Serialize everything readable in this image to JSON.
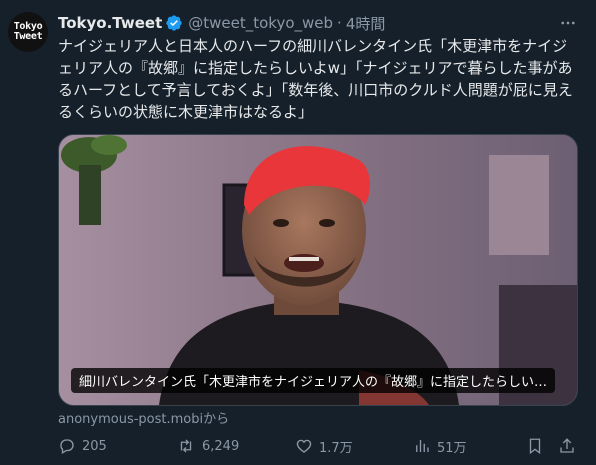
{
  "account": {
    "avatar_text_line1": "Tokyo",
    "avatar_text_line2": "Tweet",
    "name": "Tokyo.Tweet",
    "handle": "@tweet_tokyo_web",
    "separator": "·",
    "time": "4時間",
    "verified_color": "#1d9bf0"
  },
  "tweet": {
    "text": "ナイジェリア人と日本人のハーフの細川バレンタイン氏「木更津市をナイジェリア人の『故郷』に指定したらしいよw」「ナイジェリアで暮らした事があるハーフとして予言しておくよ」「数年後、川口市のクルド人問題が屁に見えるくらいの状態に木更津市はなるよ」"
  },
  "media": {
    "caption": "細川バレンタイン氏「木更津市をナイジェリア人の『故郷』に指定したらしい…",
    "source": "anonymous-post.mobiから"
  },
  "actions": {
    "reply_count": "205",
    "retweet_count": "6,249",
    "like_count": "1.7万",
    "view_count": "51万",
    "icon_color": "#8b98a5"
  },
  "colors": {
    "background": "#15202b",
    "text": "#e7e9ea",
    "muted": "#8b98a5"
  }
}
